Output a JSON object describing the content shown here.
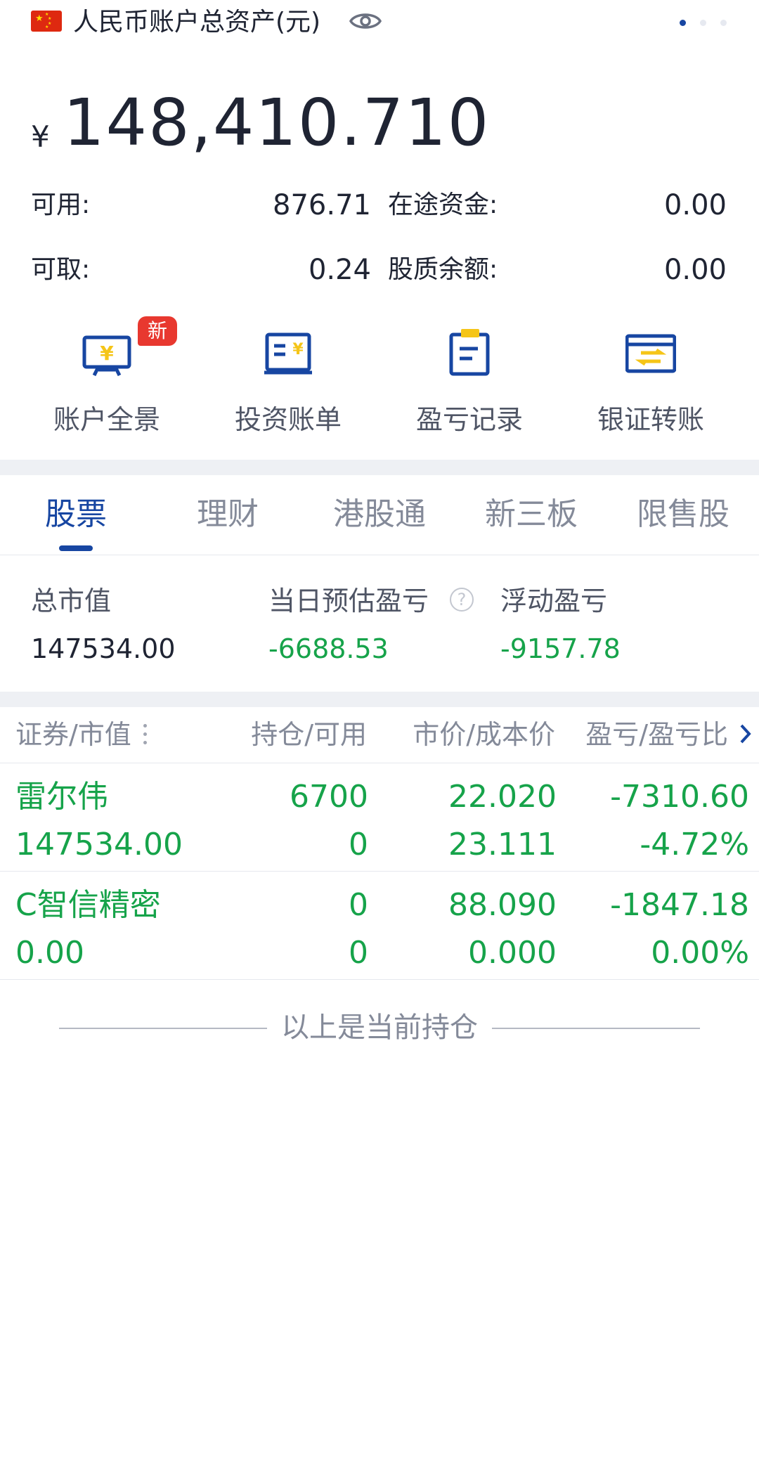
{
  "header": {
    "account_title": "人民币账户总资产(元)",
    "page_indicator_count": 3,
    "active_page_index": 0
  },
  "total": {
    "currency_symbol": "¥",
    "amount": "148,410.710"
  },
  "balances": [
    {
      "label": "可用:",
      "value": "876.71"
    },
    {
      "label": "在途资金:",
      "value": "0.00"
    },
    {
      "label": "可取:",
      "value": "0.24"
    },
    {
      "label": "股质余额:",
      "value": "0.00"
    }
  ],
  "quick_actions": [
    {
      "label": "账户全景",
      "icon": "monitor-yen-icon"
    },
    {
      "label": "投资账单",
      "icon": "bill-icon"
    },
    {
      "label": "盈亏记录",
      "icon": "clipboard-icon"
    },
    {
      "label": "银证转账",
      "icon": "card-transfer-icon"
    }
  ],
  "badge_new": "新",
  "tabs": [
    {
      "label": "股票",
      "active": true
    },
    {
      "label": "理财",
      "active": false
    },
    {
      "label": "港股通",
      "active": false
    },
    {
      "label": "新三板",
      "active": false
    },
    {
      "label": "限售股",
      "active": false
    }
  ],
  "summary": {
    "market_value_label": "总市值",
    "market_value": "147534.00",
    "daily_pl_label": "当日预估盈亏",
    "daily_pl": "-6688.53",
    "floating_pl_label": "浮动盈亏",
    "floating_pl": "-9157.78",
    "help_glyph": "?"
  },
  "table": {
    "headers": [
      "证券/市值",
      "持仓/可用",
      "市价/成本价",
      "盈亏/盈亏比"
    ],
    "rows": [
      {
        "name": "雷尔伟",
        "market_value": "147534.00",
        "position": "6700",
        "available": "0",
        "price": "22.020",
        "cost": "23.111",
        "pl": "-7310.60",
        "pl_ratio": "-4.72%"
      },
      {
        "name": "C智信精密",
        "market_value": "0.00",
        "position": "0",
        "available": "0",
        "price": "88.090",
        "cost": "0.000",
        "pl": "-1847.18",
        "pl_ratio": "0.00%"
      }
    ]
  },
  "end_note": "以上是当前持仓",
  "colors": {
    "accent": "#1746a2",
    "accent_yellow": "#f5c518",
    "loss_green": "#16a34a",
    "badge_red": "#e8382f",
    "band": "#eef0f4"
  }
}
